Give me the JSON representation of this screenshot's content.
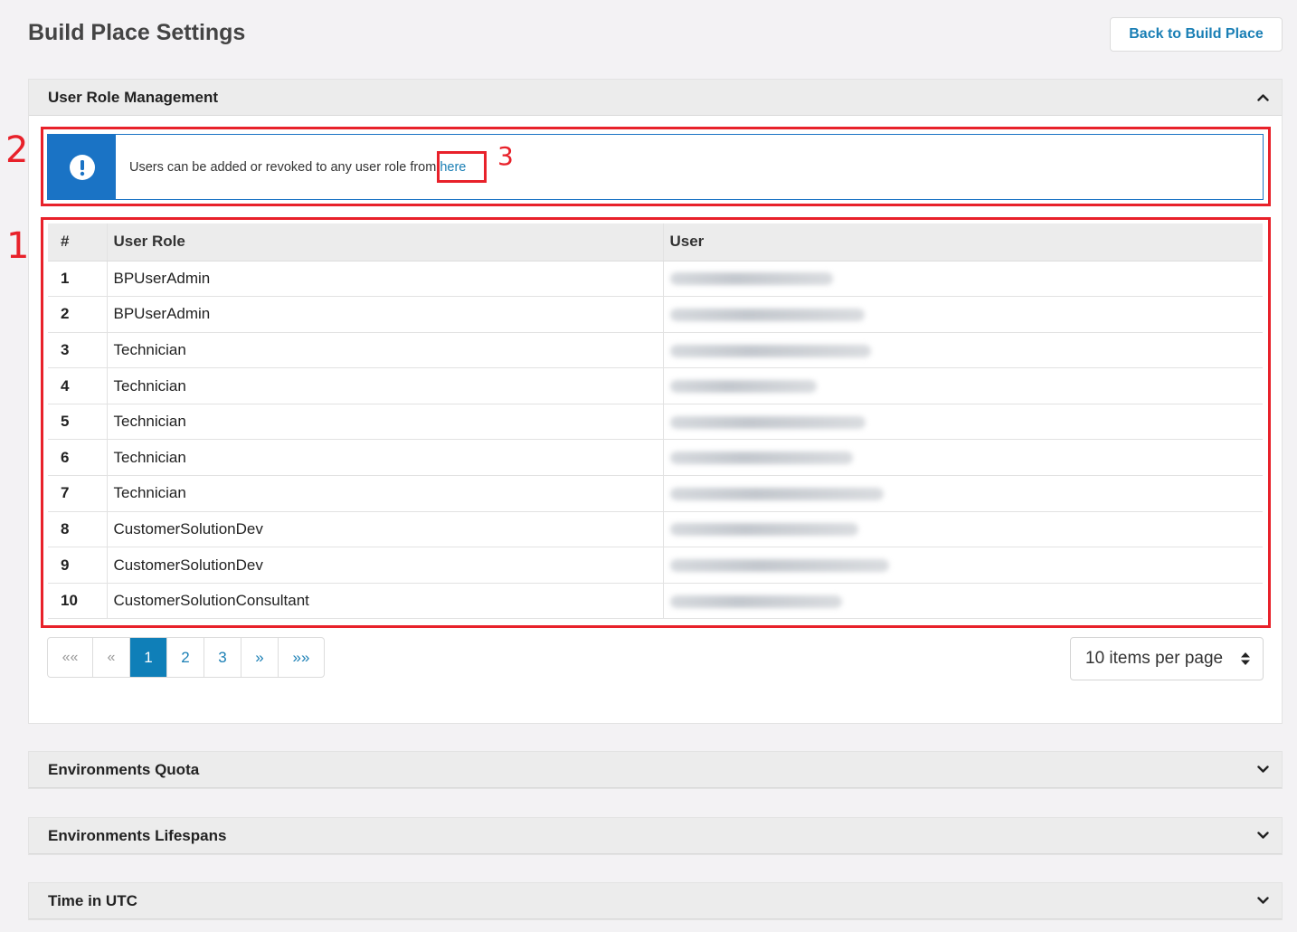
{
  "page": {
    "title": "Build Place Settings",
    "back_button": "Back to Build Place"
  },
  "panels": {
    "user_role_management": {
      "title": "User Role Management",
      "state": "expanded"
    },
    "environments_quota": {
      "title": "Environments Quota",
      "state": "collapsed"
    },
    "environments_lifespans": {
      "title": "Environments Lifespans",
      "state": "collapsed"
    },
    "time_in_utc": {
      "title": "Time in UTC",
      "state": "collapsed"
    }
  },
  "alert": {
    "icon": "exclamation-circle-icon",
    "text": "Users can be added or revoked to any user role from",
    "link_text": "here"
  },
  "annotations": {
    "a1": "1",
    "a2": "2",
    "a3": "3",
    "color": "#e8212a"
  },
  "table": {
    "headers": {
      "num": "#",
      "role": "User Role",
      "user": "User"
    },
    "rows": [
      {
        "num": "1",
        "role": "BPUserAdmin"
      },
      {
        "num": "2",
        "role": "BPUserAdmin"
      },
      {
        "num": "3",
        "role": "Technician"
      },
      {
        "num": "4",
        "role": "Technician"
      },
      {
        "num": "5",
        "role": "Technician"
      },
      {
        "num": "6",
        "role": "Technician"
      },
      {
        "num": "7",
        "role": "Technician"
      },
      {
        "num": "8",
        "role": "CustomerSolutionDev"
      },
      {
        "num": "9",
        "role": "CustomerSolutionDev"
      },
      {
        "num": "10",
        "role": "CustomerSolutionConsultant"
      }
    ]
  },
  "pagination": {
    "first": "««",
    "prev": "«",
    "pages": [
      "1",
      "2",
      "3"
    ],
    "current": "1",
    "next": "»",
    "last": "»»"
  },
  "per_page": {
    "value": "10 items per page"
  },
  "colors": {
    "accent": "#1a73c5",
    "link": "#1a7fb5",
    "active_page": "#0f7fb8"
  }
}
